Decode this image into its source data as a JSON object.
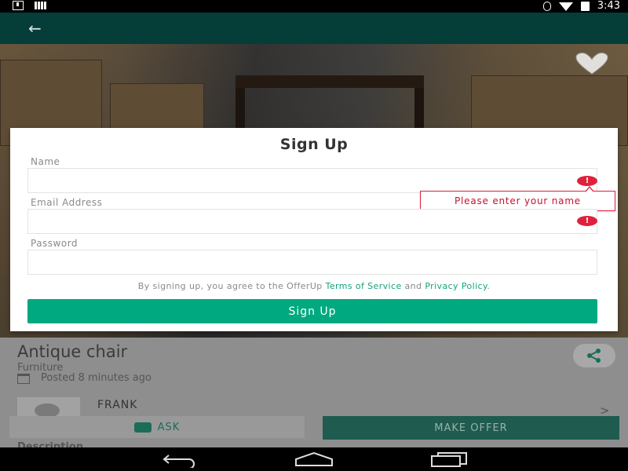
{
  "status_bar": {
    "time": "3:43"
  },
  "listing": {
    "title": "Antique chair",
    "category": "Furniture",
    "posted": "Posted 8 minutes ago",
    "seller_name": "FRANK",
    "chevron": ">",
    "ask_label": "ASK",
    "make_offer_label": "MAKE OFFER",
    "description_label": "Description"
  },
  "modal": {
    "title": "Sign Up",
    "name_label": "Name",
    "name_value": "",
    "email_label": "Email Address",
    "email_value": "",
    "password_label": "Password",
    "password_value": "",
    "error_tooltip": "Please enter your name",
    "error_glyph": "!",
    "terms_prefix": "By signing up, you agree to the OfferUp ",
    "terms_link": "Terms of Service",
    "terms_and": " and ",
    "privacy_link": "Privacy Policy",
    "terms_suffix": ".",
    "submit_label": "Sign Up"
  },
  "colors": {
    "app_bar": "#053d38",
    "accent": "#00a97f",
    "error": "#e0203c"
  },
  "icons": [
    "back-arrow-icon",
    "heart-icon",
    "share-icon",
    "calendar-icon",
    "chat-icon",
    "error-icon",
    "nav-back-icon",
    "nav-home-icon",
    "nav-recents-icon"
  ]
}
